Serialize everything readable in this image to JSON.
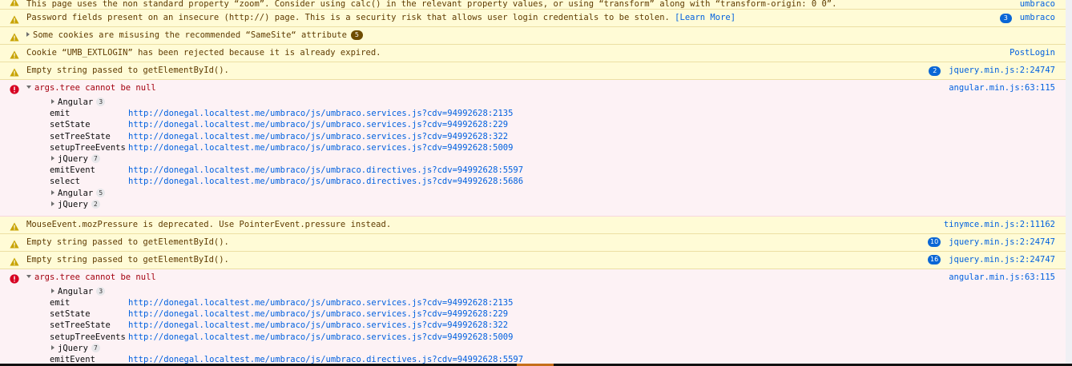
{
  "rows": [
    {
      "type": "warning",
      "message": "This page uses the non standard property “zoom”. Consider using calc() in the relevant property values, or using “transform” along with “transform-origin: 0 0”.",
      "source": "umbraco"
    },
    {
      "type": "warning",
      "message": "Password fields present on an insecure (http://) page. This is a security risk that allows user login credentials to be stolen.",
      "link": "[Learn More]",
      "count": "3",
      "source": "umbraco"
    },
    {
      "type": "warning",
      "message": "Some cookies are misusing the recommended “SameSite“ attribute",
      "group_count": "5"
    },
    {
      "type": "warning",
      "message": "Cookie “UMB_EXTLOGIN” has been rejected because it is already expired.",
      "source": "PostLogin"
    },
    {
      "type": "warning",
      "message": "Empty string passed to getElementById().",
      "count": "2",
      "source": "jquery.min.js:2:24747"
    },
    {
      "type": "error",
      "message": "args.tree cannot be null",
      "source": "angular.min.js:63:115",
      "trace": [
        {
          "group": "Angular",
          "count": "3"
        },
        {
          "fn": "emit",
          "src": "http://donegal.localtest.me/umbraco/js/umbraco.services.js?cdv=94992628:2135"
        },
        {
          "fn": "setState",
          "src": "http://donegal.localtest.me/umbraco/js/umbraco.services.js?cdv=94992628:229"
        },
        {
          "fn": "setTreeState",
          "src": "http://donegal.localtest.me/umbraco/js/umbraco.services.js?cdv=94992628:322"
        },
        {
          "fn": "setupTreeEvents",
          "src": "http://donegal.localtest.me/umbraco/js/umbraco.services.js?cdv=94992628:5009"
        },
        {
          "group": "jQuery",
          "count": "7"
        },
        {
          "fn": "emitEvent",
          "src": "http://donegal.localtest.me/umbraco/js/umbraco.directives.js?cdv=94992628:5597"
        },
        {
          "fn": "select",
          "src": "http://donegal.localtest.me/umbraco/js/umbraco.directives.js?cdv=94992628:5686"
        },
        {
          "group": "Angular",
          "count": "5"
        },
        {
          "group": "jQuery",
          "count": "2"
        }
      ]
    },
    {
      "type": "warning",
      "message": "MouseEvent.mozPressure is deprecated. Use PointerEvent.pressure instead.",
      "source": "tinymce.min.js:2:11162"
    },
    {
      "type": "warning",
      "message": "Empty string passed to getElementById().",
      "count": "10",
      "source": "jquery.min.js:2:24747"
    },
    {
      "type": "warning",
      "message": "Empty string passed to getElementById().",
      "count": "16",
      "source": "jquery.min.js:2:24747"
    },
    {
      "type": "error",
      "message": "args.tree cannot be null",
      "source": "angular.min.js:63:115",
      "trace": [
        {
          "group": "Angular",
          "count": "3"
        },
        {
          "fn": "emit",
          "src": "http://donegal.localtest.me/umbraco/js/umbraco.services.js?cdv=94992628:2135"
        },
        {
          "fn": "setState",
          "src": "http://donegal.localtest.me/umbraco/js/umbraco.services.js?cdv=94992628:229"
        },
        {
          "fn": "setTreeState",
          "src": "http://donegal.localtest.me/umbraco/js/umbraco.services.js?cdv=94992628:322"
        },
        {
          "fn": "setupTreeEvents",
          "src": "http://donegal.localtest.me/umbraco/js/umbraco.services.js?cdv=94992628:5009"
        },
        {
          "group": "jQuery",
          "count": "7"
        },
        {
          "fn": "emitEvent",
          "src": "http://donegal.localtest.me/umbraco/js/umbraco.directives.js?cdv=94992628:5597"
        }
      ]
    }
  ],
  "colors": {
    "warning_bg": "#fffbd6",
    "error_bg": "#fdf2f5",
    "warning_icon": "#c8a300",
    "error_icon": "#d70022",
    "link": "#0060df",
    "badge": "#0a66d6"
  },
  "icons": {
    "warning": "warning-icon",
    "error": "error-icon",
    "expander": "disclosure-triangle-icon"
  }
}
